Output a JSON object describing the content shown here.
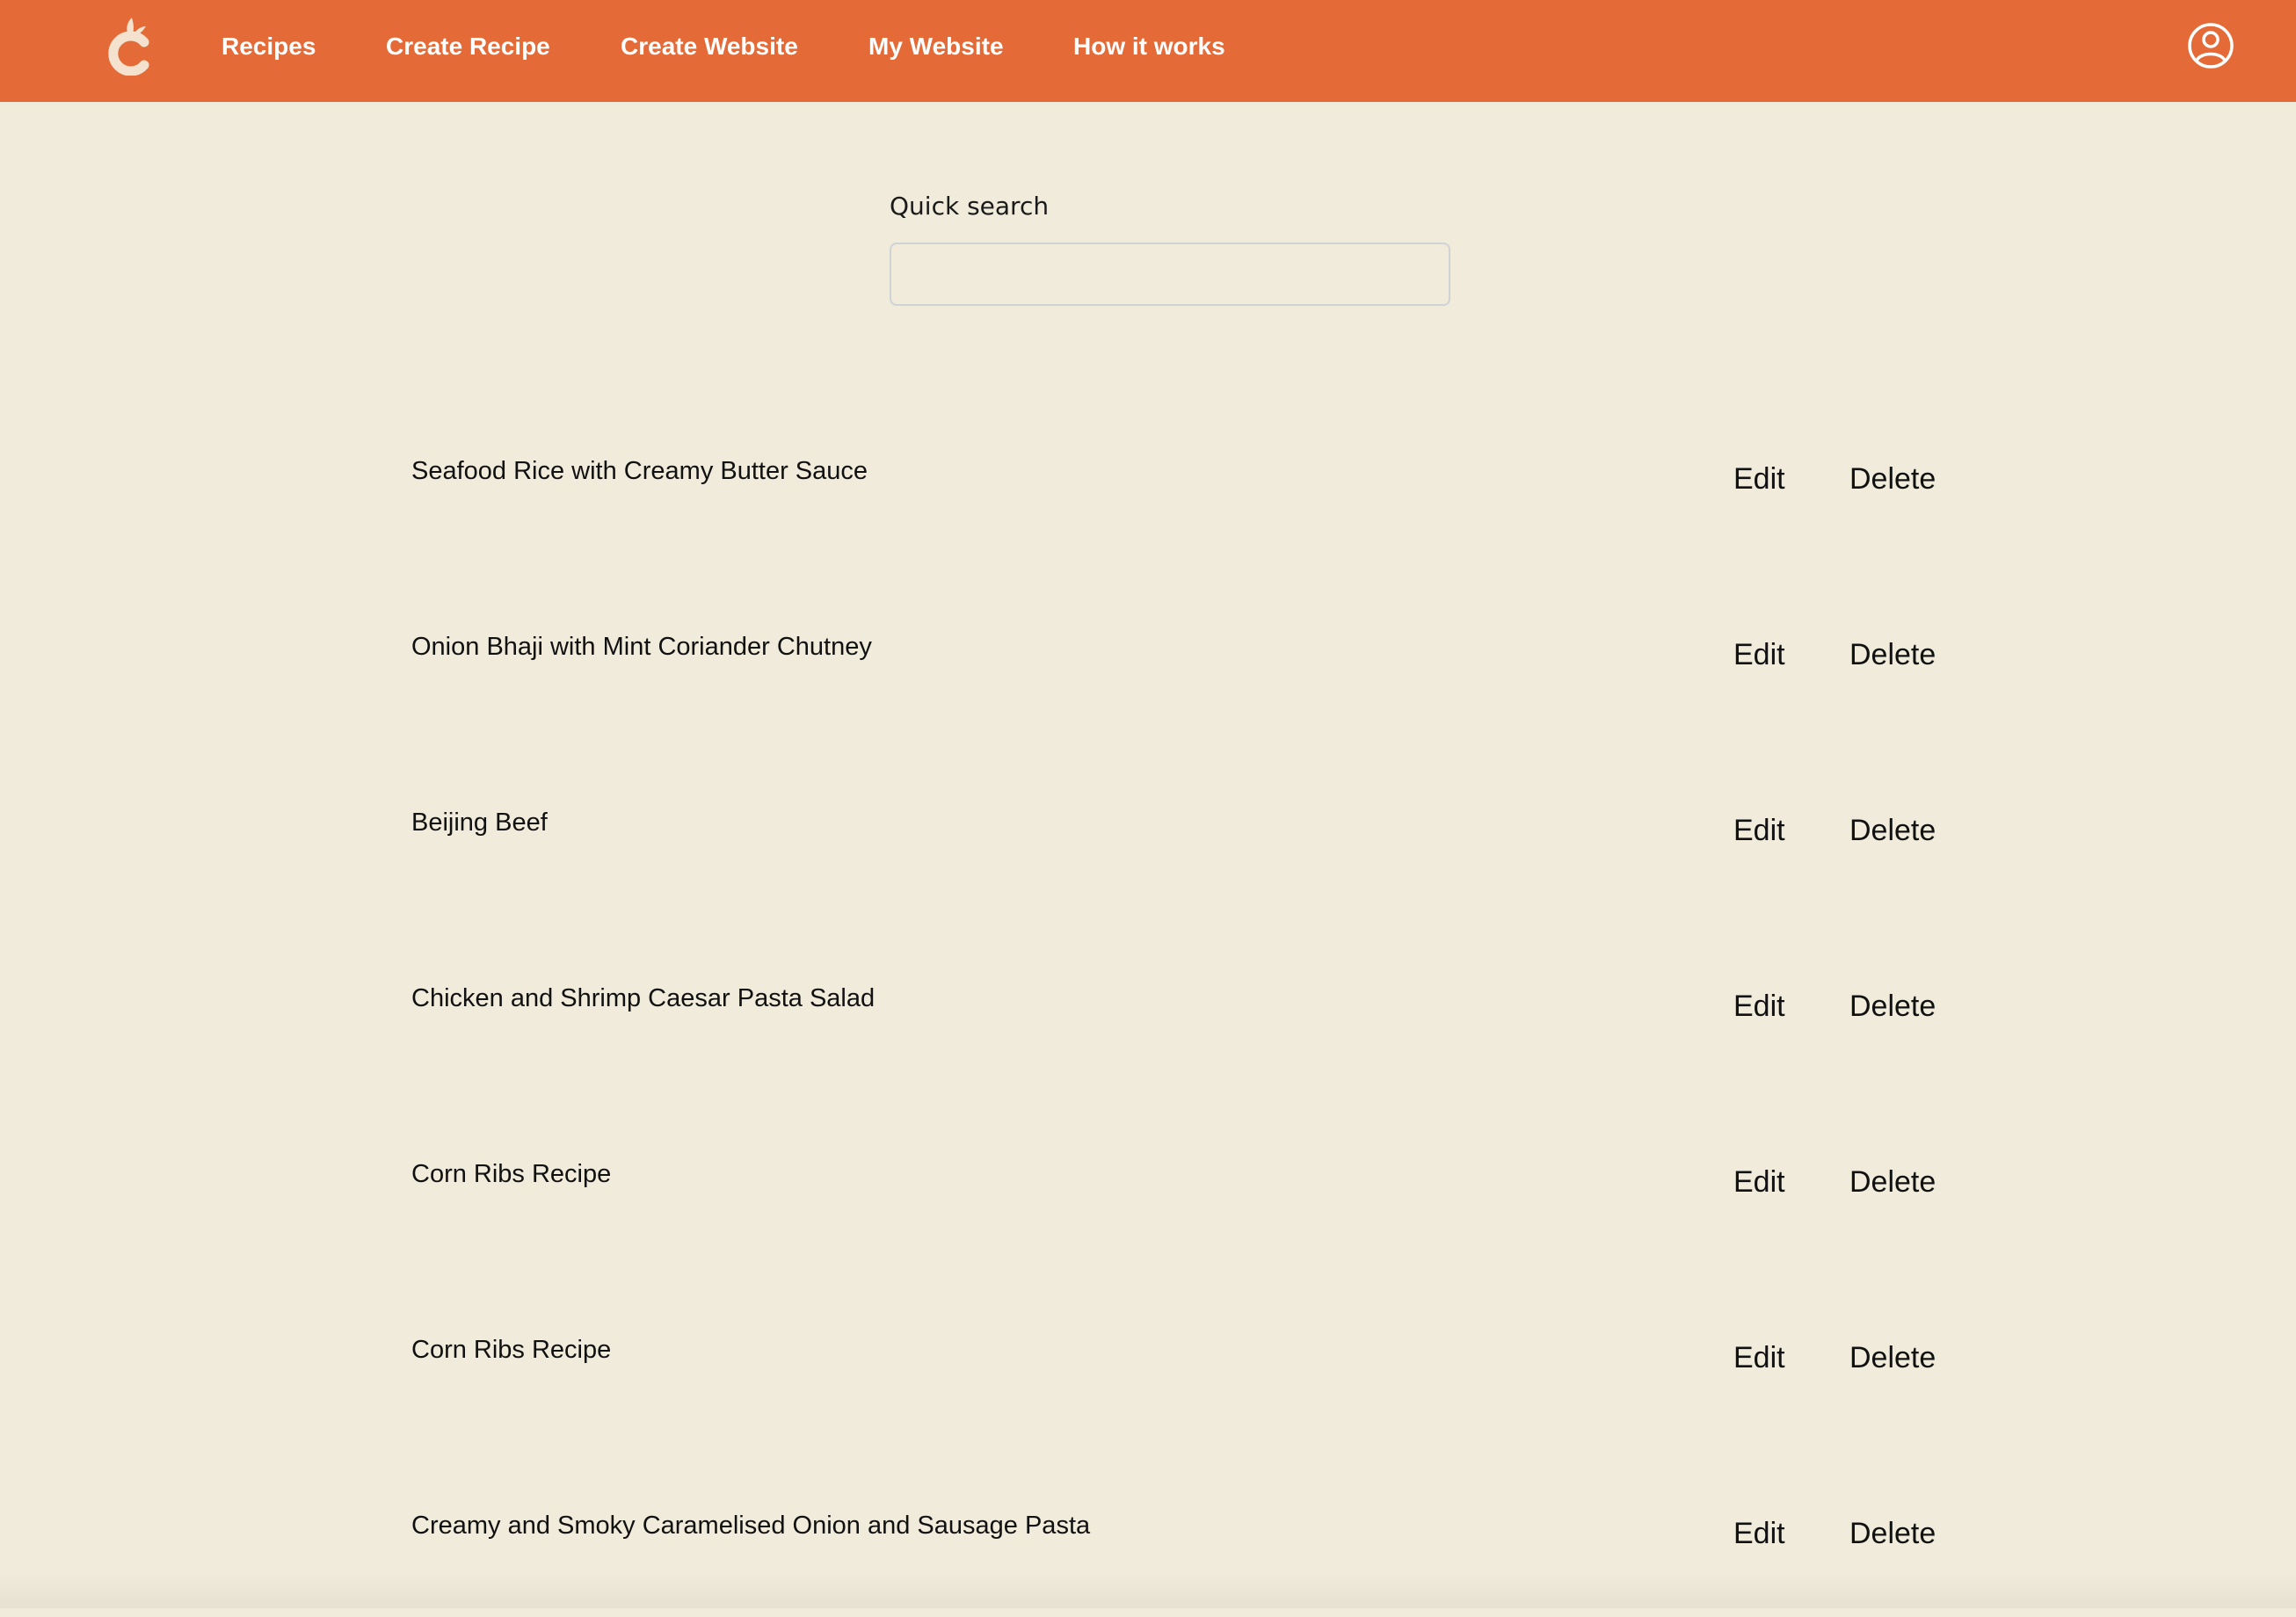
{
  "header": {
    "nav": [
      {
        "label": "Recipes"
      },
      {
        "label": "Create Recipe"
      },
      {
        "label": "Create Website"
      },
      {
        "label": "My Website"
      },
      {
        "label": "How it works"
      }
    ],
    "logo_icon": "chef-c-logo-icon",
    "account_icon": "user-circle-icon"
  },
  "search": {
    "label": "Quick search",
    "value": "",
    "placeholder": ""
  },
  "recipes": [
    {
      "title": "Seafood Rice with Creamy Butter Sauce",
      "edit_label": "Edit",
      "delete_label": "Delete"
    },
    {
      "title": "Onion Bhaji with Mint Coriander Chutney",
      "edit_label": "Edit",
      "delete_label": "Delete"
    },
    {
      "title": "Beijing Beef",
      "edit_label": "Edit",
      "delete_label": "Delete"
    },
    {
      "title": "Chicken and Shrimp Caesar Pasta Salad",
      "edit_label": "Edit",
      "delete_label": "Delete"
    },
    {
      "title": "Corn Ribs Recipe",
      "edit_label": "Edit",
      "delete_label": "Delete"
    },
    {
      "title": "Corn Ribs Recipe",
      "edit_label": "Edit",
      "delete_label": "Delete"
    },
    {
      "title": "Creamy and Smoky Caramelised Onion and Sausage Pasta",
      "edit_label": "Edit",
      "delete_label": "Delete"
    }
  ],
  "colors": {
    "header_bg": "#e46b38",
    "page_bg": "#f0ebda",
    "logo": "#f4e2cf",
    "text": "#111111"
  }
}
